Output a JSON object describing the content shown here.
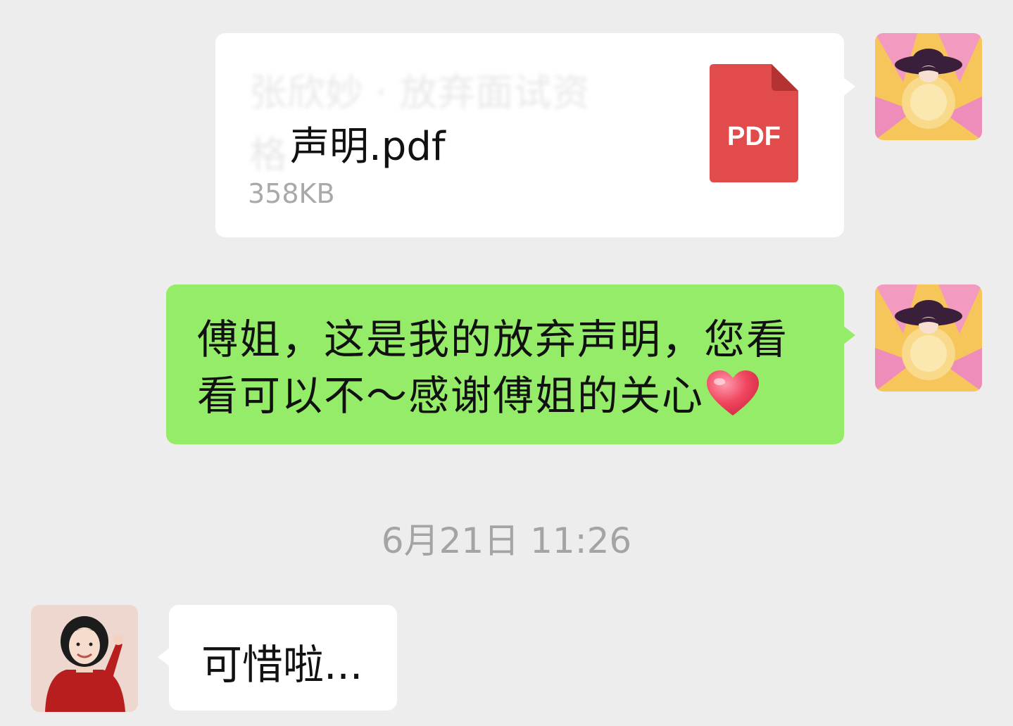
{
  "messages": {
    "file": {
      "name_blurred_line1": "张欣妙 · 放弃面试资",
      "name_blurred_prefix": "格",
      "name_visible": "声明.pdf",
      "size": "358KB",
      "icon_label": "PDF",
      "icon_color": "#e14b4b"
    },
    "sent_text": {
      "line1": "傅姐，这是我的放弃声明，您看",
      "line2": "看可以不～感谢傅姐的关心"
    },
    "timestamp": "6月21日 11:26",
    "reply": {
      "text": "可惜啦..."
    }
  },
  "avatars": {
    "me": "illustrated-woman-with-hat-avatar",
    "other": "woman-red-sweater-avatar"
  },
  "colors": {
    "background": "#ededed",
    "sent_bubble": "#95ec69",
    "received_bubble": "#ffffff"
  }
}
